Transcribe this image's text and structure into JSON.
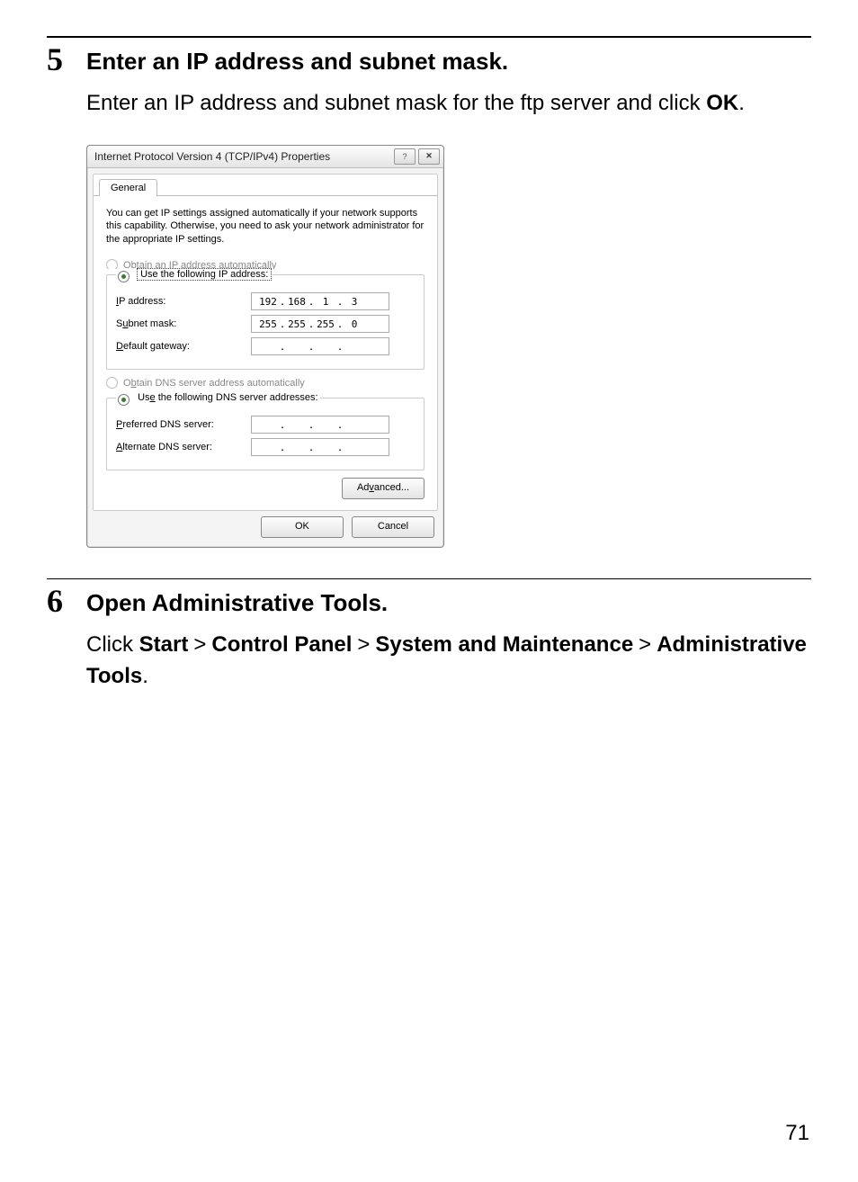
{
  "page_number": "71",
  "step5": {
    "number": "5",
    "title": "Enter an IP address and subnet mask.",
    "body_pre": "Enter an IP address and subnet mask for the ftp server and click ",
    "body_bold": "OK",
    "body_post": "."
  },
  "step6": {
    "number": "6",
    "title": "Open Administrative Tools.",
    "body_pre": "Click ",
    "seg1": "Start",
    "seg2": "Control Panel",
    "seg3": "System and Maintenance",
    "seg4": "Administrative Tools",
    "gt": ">",
    "body_post": "."
  },
  "dialog": {
    "title": "Internet Protocol Version 4 (TCP/IPv4) Properties",
    "help_glyph": "?",
    "close_glyph": "✕",
    "tab": "General",
    "explain": "You can get IP settings assigned automatically if your network supports this capability. Otherwise, you need to ask your network administrator for the appropriate IP settings.",
    "opt_auto_ip": "Obtain an IP address automatically",
    "opt_use_ip": "Use the following IP address:",
    "lbl_ip": "IP address:",
    "lbl_subnet": "Subnet mask:",
    "lbl_gateway": "Default gateway:",
    "ip": {
      "o1": "192",
      "o2": "168",
      "o3": "1",
      "o4": "3"
    },
    "subnet": {
      "o1": "255",
      "o2": "255",
      "o3": "255",
      "o4": "0"
    },
    "gateway": {
      "o1": "",
      "o2": "",
      "o3": "",
      "o4": ""
    },
    "opt_auto_dns": "Obtain DNS server address automatically",
    "opt_use_dns": "Use the following DNS server addresses:",
    "lbl_pref_dns": "Preferred DNS server:",
    "lbl_alt_dns": "Alternate DNS server:",
    "pref_dns": {
      "o1": "",
      "o2": "",
      "o3": "",
      "o4": ""
    },
    "alt_dns": {
      "o1": "",
      "o2": "",
      "o3": "",
      "o4": ""
    },
    "btn_advanced": "Advanced...",
    "btn_ok": "OK",
    "btn_cancel": "Cancel",
    "dot": "."
  }
}
